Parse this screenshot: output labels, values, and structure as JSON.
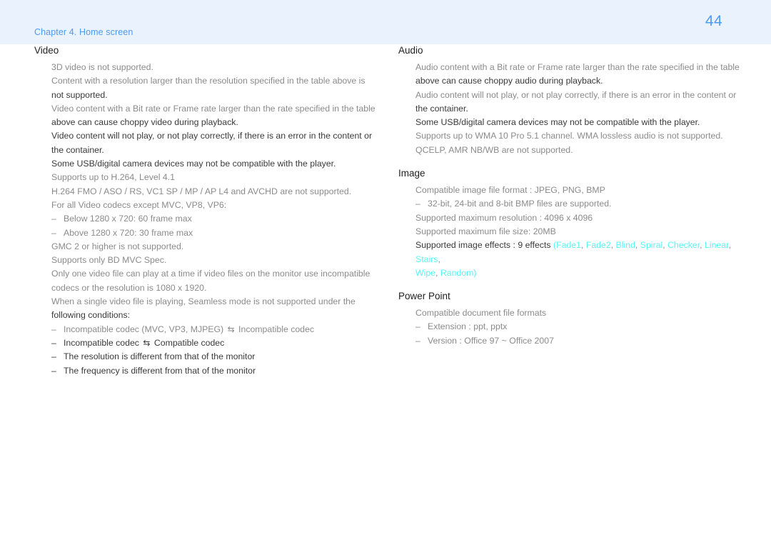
{
  "header": {
    "chapter": "Chapter 4. Home screen",
    "page_number": "44",
    "band_color": "#e9f2fd",
    "accent_color": "#4d9bf5"
  },
  "colors": {
    "text_light": "#8b8b8b",
    "text_dark": "#3a3a3a",
    "effect_cyan": "#59f3f5"
  },
  "left_column": {
    "sections": [
      {
        "title": "Video",
        "lines": [
          {
            "kind": "line",
            "tone": "light",
            "text": "3D video is not supported."
          },
          {
            "kind": "line",
            "tone": "light",
            "text": "Content with a resolution larger than the resolution specified in the table above is"
          },
          {
            "kind": "line",
            "tone": "dark",
            "text": "not supported."
          },
          {
            "kind": "line",
            "tone": "light",
            "text": "Video content with a Bit rate or Frame rate larger than the rate specified in the table"
          },
          {
            "kind": "line",
            "tone": "dark",
            "text": "above can cause choppy video during playback."
          },
          {
            "kind": "line",
            "tone": "dark",
            "text": "Video content will not play, or not play correctly, if there is an error in the content or"
          },
          {
            "kind": "line",
            "tone": "dark",
            "text": "the container."
          },
          {
            "kind": "line",
            "tone": "dark",
            "text": "Some USB/digital camera devices may not be compatible with the player."
          },
          {
            "kind": "line",
            "tone": "light",
            "text": "Supports up to H.264, Level 4.1"
          },
          {
            "kind": "line",
            "tone": "light",
            "text": "H.264 FMO / ASO / RS, VC1 SP / MP / AP L4 and AVCHD are not supported."
          },
          {
            "kind": "line",
            "tone": "light",
            "text": "For all Video codecs except MVC, VP8, VP6:"
          },
          {
            "kind": "sub",
            "tone": "light",
            "dash": "–",
            "text": "Below 1280 x 720: 60 frame max"
          },
          {
            "kind": "sub",
            "tone": "light",
            "dash": "–",
            "text": "Above 1280 x 720: 30 frame max"
          },
          {
            "kind": "line",
            "tone": "light",
            "text": "GMC 2 or higher is not supported."
          },
          {
            "kind": "line",
            "tone": "light",
            "text": "Supports only BD MVC Spec."
          },
          {
            "kind": "line",
            "tone": "light",
            "text": "Only one video file can play at a time if video files on the monitor use incompatible"
          },
          {
            "kind": "line",
            "tone": "light",
            "text": "codecs or the resolution is 1080 x 1920."
          },
          {
            "kind": "line",
            "tone": "light",
            "text": "When a single video file is playing, Seamless mode is not supported under the"
          },
          {
            "kind": "line",
            "tone": "dark",
            "text": "following conditions:"
          },
          {
            "kind": "sub",
            "tone": "light",
            "dash": "–",
            "text_before": "Incompatible codec (MVC, VP3, MJPEG) ",
            "arrow": "⇆",
            "text_after": " Incompatible codec"
          },
          {
            "kind": "sub",
            "tone": "dark",
            "dash": "–",
            "text_before": "Incompatible codec ",
            "arrow": "⇆",
            "text_after": " Compatible codec"
          },
          {
            "kind": "sub",
            "tone": "dark",
            "dash": "–",
            "text": "The resolution is different from that of the monitor"
          },
          {
            "kind": "sub",
            "tone": "dark",
            "dash": "–",
            "text": "The frequency is different from that of the monitor"
          }
        ]
      }
    ]
  },
  "right_column": {
    "sections": [
      {
        "title": "Audio",
        "lines": [
          {
            "kind": "line",
            "tone": "light",
            "text": "Audio content with a Bit rate or Frame rate larger than the rate specified in the table"
          },
          {
            "kind": "line",
            "tone": "dark",
            "text": "above can cause choppy audio during playback."
          },
          {
            "kind": "line",
            "tone": "light",
            "text": "Audio content will not play, or not play correctly, if there is an error in the content or"
          },
          {
            "kind": "line",
            "tone": "dark",
            "text": "the container."
          },
          {
            "kind": "line",
            "tone": "dark",
            "text": "Some USB/digital camera devices may not be compatible with the player."
          },
          {
            "kind": "line",
            "tone": "light",
            "text": "Supports up to WMA 10 Pro 5.1 channel. WMA lossless audio is not supported."
          },
          {
            "kind": "line",
            "tone": "light",
            "text": "QCELP, AMR NB/WB are not supported."
          }
        ]
      },
      {
        "title": "Image",
        "lines": [
          {
            "kind": "line",
            "tone": "light",
            "text": "Compatible image file format : JPEG, PNG, BMP"
          },
          {
            "kind": "sub",
            "tone": "light",
            "dash": "–",
            "text": "32-bit, 24-bit and 8-bit BMP files are supported."
          },
          {
            "kind": "line",
            "tone": "light",
            "text": "Supported maximum resolution : 4096 x 4096"
          },
          {
            "kind": "line",
            "tone": "light",
            "text": "Supported maximum file size: 20MB"
          },
          {
            "kind": "effects",
            "tone": "dark",
            "label": "Supported image effects : 9 effects ",
            "open_paren": "(",
            "effects": [
              "Fade1",
              "Fade2",
              "Blind",
              "Spiral",
              "Checker",
              "Linear",
              "Stairs",
              "Wipe",
              "Random"
            ],
            "separator": ", ",
            "close_paren": ")",
            "line_break_after": 6
          }
        ]
      },
      {
        "title": "Power Point",
        "lines": [
          {
            "kind": "line",
            "tone": "light",
            "text": "Compatible document file formats"
          },
          {
            "kind": "sub",
            "tone": "light",
            "dash": "–",
            "text": "Extension : ppt, pptx"
          },
          {
            "kind": "sub",
            "tone": "light",
            "dash": "–",
            "text": "Version : Office 97 ~ Office 2007"
          }
        ]
      }
    ]
  }
}
